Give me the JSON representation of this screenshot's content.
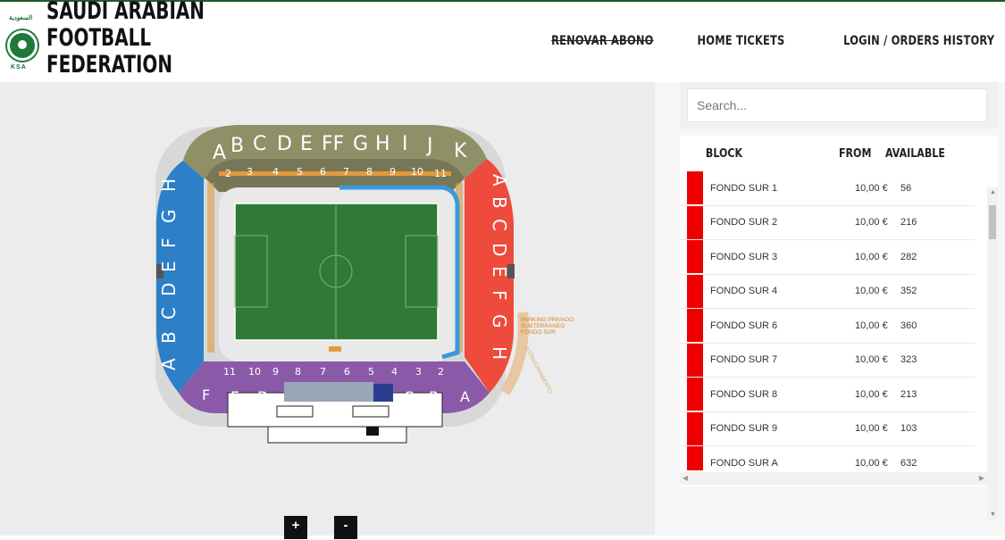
{
  "header": {
    "brand_lines": [
      "SAUDI ARABIAN",
      "FOOTBALL",
      "FEDERATION"
    ],
    "crest": {
      "arabic_text": "السعودية",
      "abbr": "KSA"
    },
    "nav": [
      {
        "label": "RENOVAR ABONO",
        "strikethrough": true
      },
      {
        "label": "HOME TICKETS",
        "strikethrough": false
      },
      {
        "label": "LOGIN / ORDERS HISTORY",
        "strikethrough": false
      }
    ]
  },
  "map": {
    "annotation_lines": [
      "PARKING PRIVADO",
      "SUBTERRANEO",
      "FONDO SUR"
    ],
    "curved_label": "ESTACIONAMIENTO",
    "top_letters": [
      "A",
      "B",
      "C",
      "D",
      "E",
      "FF",
      "G",
      "H",
      "I",
      "J",
      "K"
    ],
    "top_numbers": [
      "2",
      "3",
      "4",
      "5",
      "6",
      "7",
      "8",
      "9",
      "10",
      "11"
    ],
    "bottom_numbers": [
      "2",
      "3",
      "4",
      "5",
      "6",
      "7",
      "8",
      "9",
      "10",
      "11"
    ],
    "bottom_letters": [
      "A",
      "B",
      "C",
      "D",
      "E",
      "F"
    ],
    "left_letters": [
      "A",
      "B",
      "C",
      "D",
      "E",
      "F",
      "G",
      "H"
    ],
    "right_letters": [
      "A",
      "B",
      "C",
      "D",
      "E",
      "F",
      "G",
      "H"
    ],
    "zoom_in": "+",
    "zoom_out": "-"
  },
  "panel": {
    "search_placeholder": "Search...",
    "columns": {
      "block": "BLOCK",
      "from": "FROM",
      "available": "AVAILABLE"
    },
    "rows": [
      {
        "block": "FONDO SUR 1",
        "from": "10,00 €",
        "available": "56"
      },
      {
        "block": "FONDO SUR 2",
        "from": "10,00 €",
        "available": "216"
      },
      {
        "block": "FONDO SUR 3",
        "from": "10,00 €",
        "available": "282"
      },
      {
        "block": "FONDO SUR 4",
        "from": "10,00 €",
        "available": "352"
      },
      {
        "block": "FONDO SUR 6",
        "from": "10,00 €",
        "available": "360"
      },
      {
        "block": "FONDO SUR 7",
        "from": "10,00 €",
        "available": "323"
      },
      {
        "block": "FONDO SUR 8",
        "from": "10,00 €",
        "available": "213"
      },
      {
        "block": "FONDO SUR 9",
        "from": "10,00 €",
        "available": "103"
      },
      {
        "block": "FONDO SUR A",
        "from": "10,00 €",
        "available": "632"
      }
    ],
    "row_color": "#ee0000"
  },
  "colors": {
    "brand_green": "#1e5a2e",
    "top_stand": "#8c8c66",
    "left_stand": "#2d7fc7",
    "right_stand": "#ee4b3c",
    "bottom_stand": "#8a5aa8",
    "pitch": "#2f7a35",
    "inner_ring": "#3a9ad9"
  }
}
